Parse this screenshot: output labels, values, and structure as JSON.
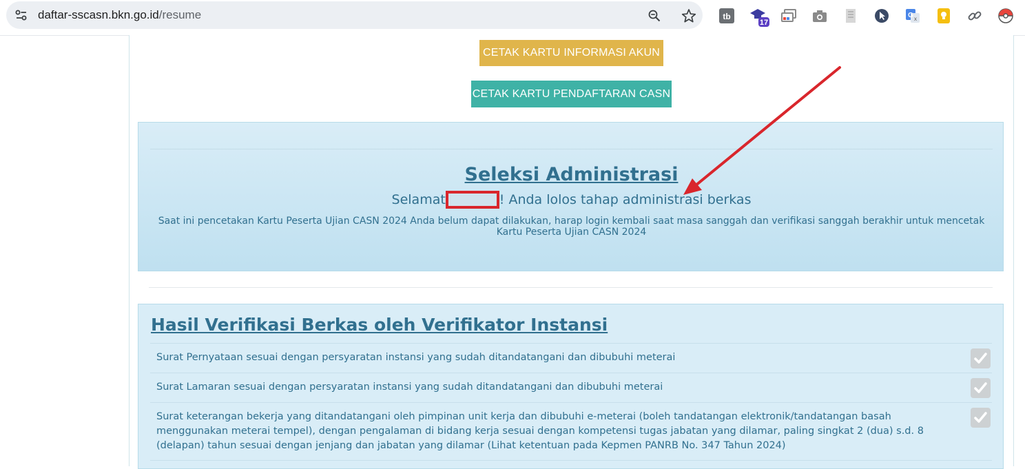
{
  "browser": {
    "url_host": "daftar-sscasn.bkn.go.id",
    "url_path": "/resume",
    "extension_badge": "17"
  },
  "buttons": {
    "akun": "CETAK KARTU INFORMASI AKUN",
    "casn": "CETAK KARTU PENDAFTARAN CASN"
  },
  "seleksi": {
    "title": "Seleksi Administrasi",
    "congrats_before": "Selamat",
    "congrats_after": "! Anda lolos tahap administrasi berkas",
    "note": "Saat ini pencetakan Kartu Peserta Ujian CASN 2024 Anda belum dapat dilakukan, harap login kembali saat masa sanggah dan verifikasi sanggah berakhir untuk mencetak Kartu Peserta Ujian CASN 2024"
  },
  "verifikasi": {
    "title": "Hasil Verifikasi Berkas oleh Verifikator Instansi",
    "items": [
      "Surat Pernyataan sesuai dengan persyaratan instansi yang sudah ditandatangani dan dibubuhi meterai",
      "Surat Lamaran sesuai dengan persyaratan instansi yang sudah ditandatangani dan dibubuhi meterai",
      "Surat keterangan bekerja yang ditandatangani oleh pimpinan unit kerja dan dibubuhi e-meterai (boleh tandatangan elektronik/tandatangan basah menggunakan meterai tempel), dengan pengalaman di bidang kerja sesuai dengan kompetensi tugas jabatan yang dilamar, paling singkat 2 (dua) s.d. 8 (delapan) tahun sesuai dengan jenjang dan jabatan yang dilamar (Lihat ketentuan pada Kepmen PANRB No. 347 Tahun 2024)"
    ]
  },
  "colors": {
    "akun_button": "#e0b54b",
    "casn_button": "#3fb2a6",
    "info_panel": "#d9edf7",
    "info_text": "#31708f",
    "annotation": "#d9262c"
  }
}
